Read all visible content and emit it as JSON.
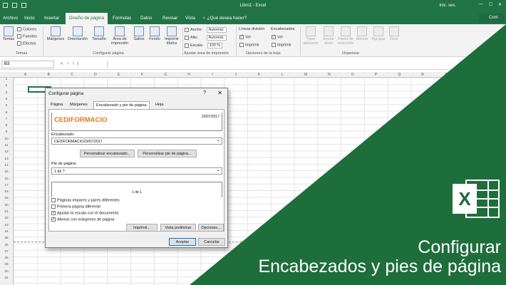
{
  "app": {
    "title": "Libro1 - Excel",
    "user": "Inic. ses."
  },
  "tabs": [
    "Archivo",
    "Inicio",
    "Insertar",
    "Diseño de página",
    "Fórmulas",
    "Datos",
    "Revisar",
    "Vista"
  ],
  "tell_me": "¿Qué desea hacer?",
  "share_label": "Com",
  "ribbon": {
    "temas": {
      "temas": "Temas",
      "colores": "Colores",
      "fuentes": "Fuentes",
      "efectos": "Efectos",
      "group": "Temas"
    },
    "configurar": {
      "margenes": "Márgenes",
      "orientacion": "Orientación",
      "tamano": "Tamaño",
      "area": "Área de impresión",
      "saltos": "Saltos",
      "fondo": "Fondo",
      "imprimir_titulos": "Imprimir títulos",
      "group": "Configurar página"
    },
    "ajustar": {
      "ancho_label": "Ancho:",
      "ancho_val": "Automát.",
      "alto_label": "Alto:",
      "alto_val": "Automát.",
      "escala_label": "Escala:",
      "escala_val": "100 %",
      "group": "Ajustar área de impresión"
    },
    "opciones": {
      "lineas": "Líneas división",
      "encabezados": "Encabezados",
      "ver1": "Ver",
      "imprimir1": "Imprimir",
      "ver2": "Ver",
      "imprimir2": "Imprimir",
      "group": "Opciones de la hoja"
    },
    "organizar": {
      "traer": "Traer adelante",
      "enviar": "Enviar atrás",
      "panel": "Panel de selección",
      "alinear": "Alinear",
      "agrupar": "Agrupar",
      "girar": "Girar",
      "group": "Organizar"
    }
  },
  "formula_bar": {
    "name_box": "B3",
    "fx": "fx"
  },
  "columns": [
    "A",
    "B",
    "C",
    "D",
    "E",
    "F",
    "G",
    "H",
    "I",
    "J",
    "K",
    "L",
    "M",
    "N",
    "O",
    "P",
    "Q",
    "R",
    "S",
    "T",
    "U"
  ],
  "rows": [
    "1",
    "2",
    "3",
    "4",
    "5",
    "6",
    "7",
    "8",
    "9",
    "10",
    "11",
    "12",
    "13",
    "14",
    "15",
    "16",
    "17",
    "18",
    "19",
    "20",
    "21",
    "22",
    "23",
    "24",
    "25",
    "26",
    "27",
    "28",
    "29",
    "30",
    "31"
  ],
  "dialog": {
    "title": "Configurar página",
    "help": "?",
    "close": "✕",
    "tabs": [
      "Página",
      "Márgenes",
      "Encabezado y pie de página",
      "Hoja"
    ],
    "header_preview_left": "CEDIFORMACIO",
    "header_preview_right": "23/07/2017",
    "header_label": "Encabezado:",
    "header_value": "CEDIFORMACIO23/07/2017",
    "custom_header_btn": "Personalizar encabezado...",
    "custom_footer_btn": "Personalizar pie de página...",
    "footer_label": "Pie de página:",
    "footer_value": "1 de ?",
    "footer_preview": "1 de 1",
    "check_odd_even": "Páginas impares y pares diferentes",
    "check_first": "Primera página diferente",
    "check_scale": "Ajustar la escala con el documento",
    "check_align": "Alinear con márgenes de página",
    "print_btn": "Imprimir...",
    "preview_btn": "Vista preliminar",
    "options_btn": "Opciones...",
    "accept_btn": "Aceptar",
    "cancel_btn": "Cancelar"
  },
  "overlay": {
    "logo_letter": "X",
    "caption_line1": "Configurar",
    "caption_line2": "Encabezados y pies de página",
    "brand_green": "#1e6e3c"
  }
}
